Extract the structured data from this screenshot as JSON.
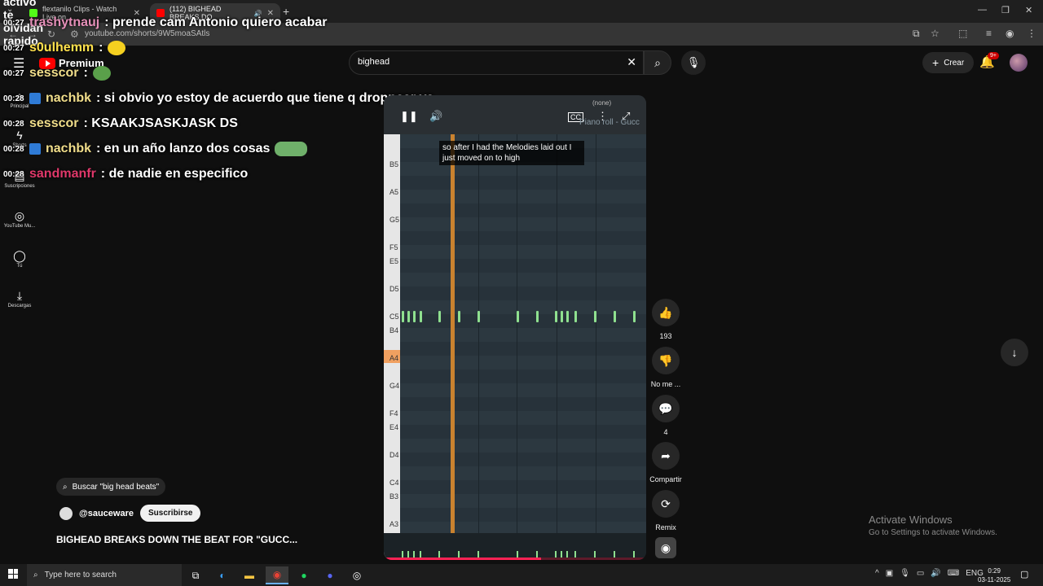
{
  "browser": {
    "tabs": [
      {
        "title": "flextanilo Clips - Watch Live on",
        "active": false
      },
      {
        "title": "(112) BIGHEAD BREAKS DO",
        "active": true
      }
    ],
    "new_tab": "+",
    "url": "youtube.com/shorts/9W5moaSAtls"
  },
  "youtube": {
    "logo_text": "Premium",
    "search_value": "bighead",
    "create_label": "Crear",
    "notif_count": "9+",
    "sidebar": [
      {
        "icon": "home-icon",
        "label": "Principal"
      },
      {
        "icon": "shorts-icon",
        "label": "Shorts"
      },
      {
        "icon": "subscriptions-icon",
        "label": "Suscripciones"
      },
      {
        "icon": "youtube-music-icon",
        "label": "YouTube Mu..."
      },
      {
        "icon": "you-icon",
        "label": "Tú"
      },
      {
        "icon": "downloads-icon",
        "label": "Descargas"
      }
    ]
  },
  "chat": {
    "top_fragment": "activo te olvidan rapido",
    "lines": [
      {
        "time": "00:27",
        "user": "trashytnauj",
        "user_color": "#e58fb8",
        "msg": ": prende cam Antonio quiero acabar"
      },
      {
        "time": "00:27",
        "user": "s0ulhemm",
        "user_color": "#ffe14d",
        "msg": ":"
      },
      {
        "time": "00:27",
        "user": "sesscor",
        "user_color": "#f0dd8a",
        "msg": ":"
      },
      {
        "time": "00:28",
        "user": "nachbk",
        "user_color": "#f0dd8a",
        "msg": ": si obvio yo estoy de acuerdo que tiene q droppear ya"
      },
      {
        "time": "00:28",
        "user": "sesscor",
        "user_color": "#f0dd8a",
        "msg": ": KSAAKJSASKJASK DS"
      },
      {
        "time": "00:28",
        "user": "nachbk",
        "user_color": "#f0dd8a",
        "msg": ": en un año lanzo dos cosas"
      },
      {
        "time": "00:28",
        "user": "sandmanfr",
        "user_color": "#e0386a",
        "msg": ": de nadie en especifico"
      }
    ]
  },
  "video": {
    "caption": "so after I had the Melodies laid out I just moved on to high",
    "none_label": "(none)",
    "piano_roll_label": "Piano roll - Gucc",
    "cc_label": "CC",
    "key_labels": [
      "B5",
      "A5",
      "G5",
      "F5",
      "E5",
      "D5",
      "C5",
      "B4",
      "A4",
      "G4",
      "F4",
      "E4",
      "D4",
      "C4",
      "B3",
      "A3"
    ],
    "progress": 0.6
  },
  "actions": {
    "like_count": "193",
    "dislike_label": "No me ...",
    "comments_count": "4",
    "share_label": "Compartir",
    "remix_label": "Remix"
  },
  "shorts_info": {
    "search_chip": "Buscar \"big head beats\"",
    "channel": "@sauceware",
    "subscribe_label": "Suscribirse",
    "title": "BIGHEAD BREAKS DOWN THE BEAT FOR \"GUCC..."
  },
  "activate": {
    "line1": "Activate Windows",
    "line2": "Go to Settings to activate Windows."
  },
  "taskbar": {
    "search_placeholder": "Type here to search",
    "lang": "ENG",
    "time": "0:29",
    "date": "03-11-2025"
  }
}
